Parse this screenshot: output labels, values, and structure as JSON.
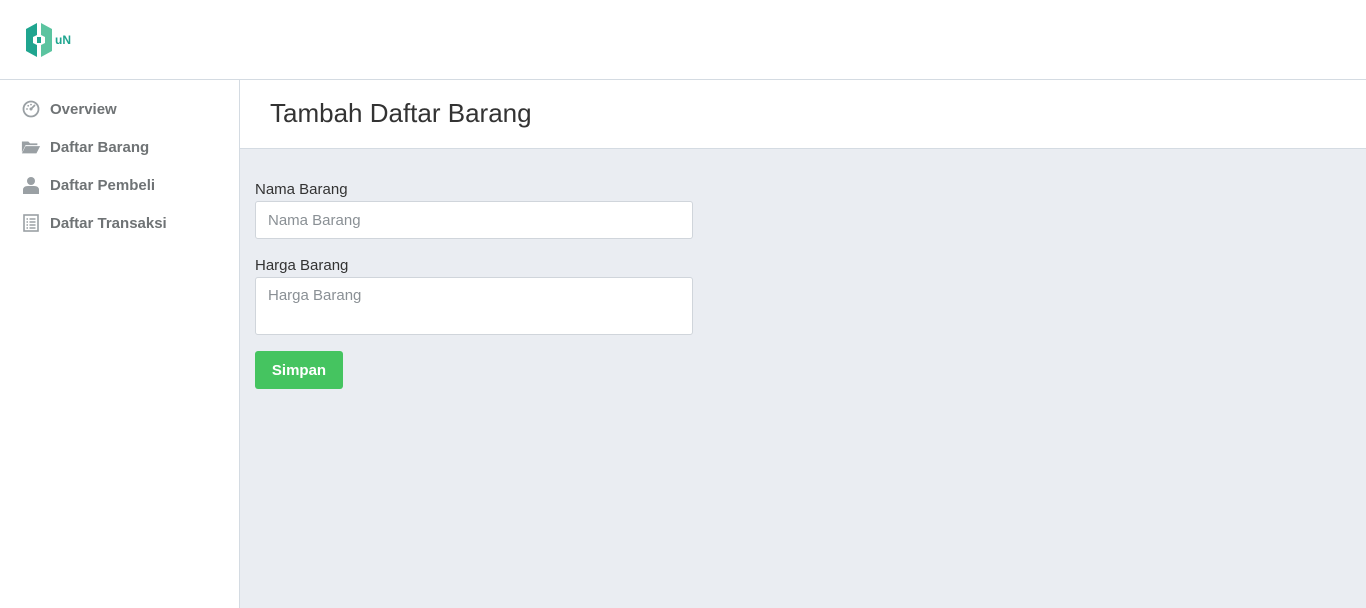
{
  "logo": {
    "text": "uN"
  },
  "sidebar": {
    "items": [
      {
        "label": "Overview",
        "icon": "dashboard-icon"
      },
      {
        "label": "Daftar Barang",
        "icon": "folder-open-icon"
      },
      {
        "label": "Daftar Pembeli",
        "icon": "user-icon"
      },
      {
        "label": "Daftar Transaksi",
        "icon": "list-icon"
      }
    ]
  },
  "page": {
    "title": "Tambah Daftar Barang"
  },
  "form": {
    "nama_label": "Nama Barang",
    "nama_placeholder": "Nama Barang",
    "nama_value": "",
    "harga_label": "Harga Barang",
    "harga_placeholder": "Harga Barang",
    "harga_value": "",
    "submit_label": "Simpan"
  },
  "colors": {
    "brand": "#1fa58f",
    "button": "#45c460",
    "main_bg": "#eaedf2",
    "nav_text": "#6f7375"
  }
}
